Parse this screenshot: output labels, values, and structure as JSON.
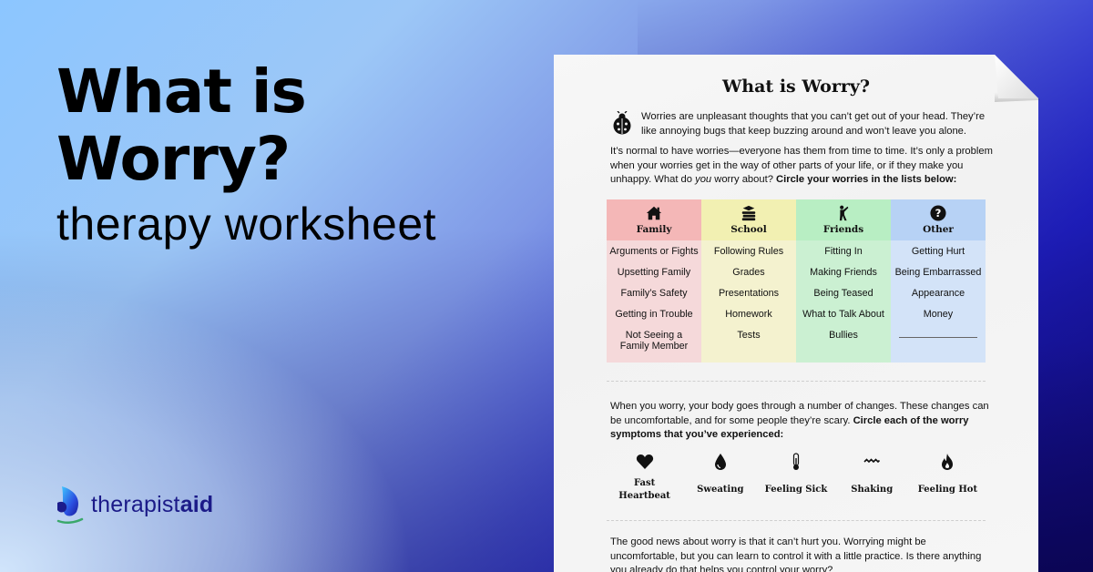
{
  "hero": {
    "title": "What is Worry?",
    "subtitle": "therapy worksheet"
  },
  "brand": {
    "name_light": "therapist",
    "name_bold": "aid",
    "logo_icon": "butterfly-icon",
    "color": "#1b1a88"
  },
  "worksheet": {
    "title": "What is Worry?",
    "intro_icon": "ladybug-icon",
    "intro_text": "Worries are unpleasant thoughts that you can’t get out of your head. They’re like annoying bugs that keep buzzing around and won’t leave you alone.",
    "para1_a": "It’s normal to have worries—everyone has them from time to time. It’s only a problem when your worries get in the way of other parts of your life, or if they make you unhappy. What do ",
    "para1_em": "you",
    "para1_b": " worry about? ",
    "para1_bold": "Circle your worries in the lists below:",
    "categories": [
      {
        "label": "Family",
        "icon": "house-icon",
        "color": "#f4b7b7",
        "items": [
          "Arguments or Fights",
          "Upsetting Family",
          "Family’s Safety",
          "Getting in Trouble",
          "Not Seeing a\nFamily Member"
        ]
      },
      {
        "label": "School",
        "icon": "books-icon",
        "color": "#f2f0b2",
        "items": [
          "Following Rules",
          "Grades",
          "Presentations",
          "Homework",
          "Tests"
        ]
      },
      {
        "label": "Friends",
        "icon": "person-waving-icon",
        "color": "#b8eec3",
        "items": [
          "Fitting In",
          "Making Friends",
          "Being Teased",
          "What to Talk About",
          "Bullies"
        ]
      },
      {
        "label": "Other",
        "icon": "question-circle-icon",
        "color": "#b7d2f5",
        "items": [
          "Getting Hurt",
          "Being Embarrassed",
          "Appearance",
          "Money"
        ]
      }
    ],
    "para2_a": "When you worry, your body goes through a number of changes. These changes can be uncomfortable, and for some people they’re scary. ",
    "para2_bold": "Circle each of the worry symptoms that you’ve experienced:",
    "symptoms": [
      {
        "label": "Fast\nHeartbeat",
        "icon": "heart-icon"
      },
      {
        "label": "Sweating",
        "icon": "drop-icon"
      },
      {
        "label": "Feeling Sick",
        "icon": "thermometer-icon"
      },
      {
        "label": "Shaking",
        "icon": "wave-icon"
      },
      {
        "label": "Feeling Hot",
        "icon": "flame-icon"
      }
    ],
    "para3": "The good news about worry is that it can’t hurt you. Worrying might be uncomfortable, but you can learn to control it with a little practice. Is there anything you already do that helps you control your worry?"
  }
}
